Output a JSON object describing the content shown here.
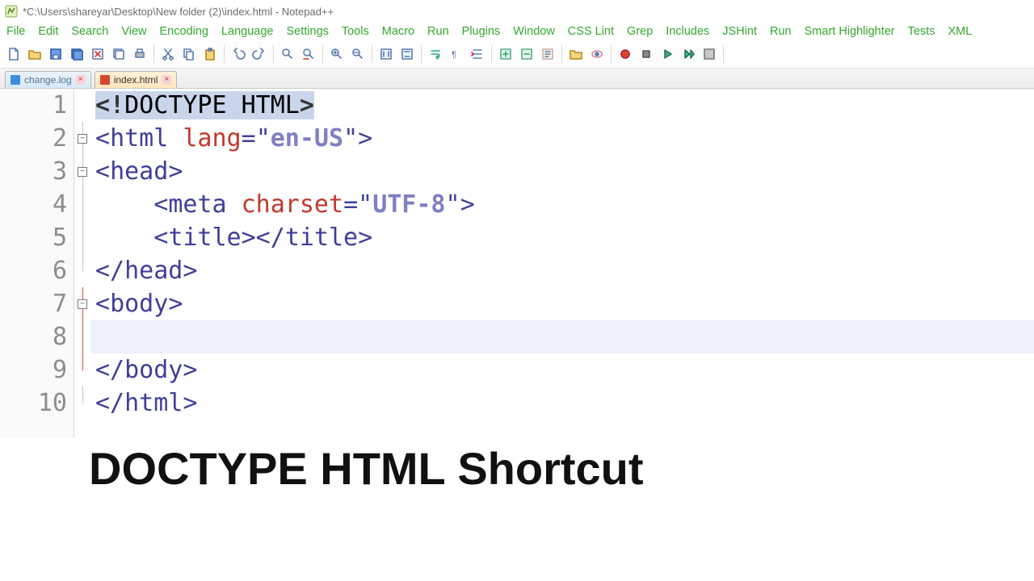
{
  "window": {
    "title": "*C:\\Users\\shareyar\\Desktop\\New folder (2)\\index.html - Notepad++"
  },
  "menu": [
    "File",
    "Edit",
    "Search",
    "View",
    "Encoding",
    "Language",
    "Settings",
    "Tools",
    "Macro",
    "Run",
    "Plugins",
    "Window",
    "CSS Lint",
    "Grep",
    "Includes",
    "JSHint",
    "Run",
    "Smart Highlighter",
    "Tests",
    "XML"
  ],
  "toolbar_icons": [
    "new-file-icon",
    "open-file-icon",
    "save-icon",
    "save-all-icon",
    "close-icon",
    "close-all-icon",
    "print-icon",
    "cut-icon",
    "copy-icon",
    "paste-icon",
    "undo-icon",
    "redo-icon",
    "find-icon",
    "replace-icon",
    "zoom-in-icon",
    "zoom-out-icon",
    "sync-v-icon",
    "sync-h-icon",
    "wrap-icon",
    "show-ws-icon",
    "indent-guide-icon",
    "fold-icon",
    "unfold-icon",
    "function-list-icon",
    "folder-icon",
    "monitor-icon",
    "record-icon",
    "stop-icon",
    "play-icon",
    "playn-icon",
    "save-macro-icon"
  ],
  "tabs": [
    {
      "label": "change.log",
      "active": false,
      "icon": "blue"
    },
    {
      "label": "index.html",
      "active": true,
      "icon": "red"
    }
  ],
  "gutter": [
    "1",
    "2",
    "3",
    "4",
    "5",
    "6",
    "7",
    "8",
    "9",
    "10"
  ],
  "fold": [
    {
      "marker": null
    },
    {
      "marker": "minus",
      "guide": true
    },
    {
      "marker": "minus",
      "guide": true
    },
    {
      "guide": true
    },
    {
      "guide": true
    },
    {
      "guide": true,
      "end": true
    },
    {
      "marker": "minus",
      "guide": true,
      "red": true
    },
    {
      "guide": true,
      "red": true
    },
    {
      "guide": true,
      "red": true,
      "end": true
    },
    {
      "guide": true,
      "end": true
    }
  ],
  "code": [
    {
      "type": "doctype",
      "raw": "<!DOCTYPE HTML>"
    },
    {
      "type": "open",
      "tag": "html",
      "attrs": [
        {
          "n": "lang",
          "v": "en-US"
        }
      ]
    },
    {
      "type": "open",
      "tag": "head"
    },
    {
      "type": "void",
      "indent": "    ",
      "tag": "meta",
      "attrs": [
        {
          "n": "charset",
          "v": "UTF-8"
        }
      ]
    },
    {
      "type": "pair",
      "indent": "    ",
      "tag": "title"
    },
    {
      "type": "close",
      "tag": "head"
    },
    {
      "type": "open",
      "tag": "body"
    },
    {
      "type": "blank",
      "highlight": true,
      "indent": "    "
    },
    {
      "type": "close",
      "tag": "body"
    },
    {
      "type": "close",
      "tag": "html"
    }
  ],
  "caption": "DOCTYPE HTML Shortcut",
  "colors": {
    "menu": "#34a72f",
    "tag": "#3f3f9a",
    "attr": "#c0392b",
    "str": "#7f7fc5",
    "highlight": "#eef0fb"
  }
}
